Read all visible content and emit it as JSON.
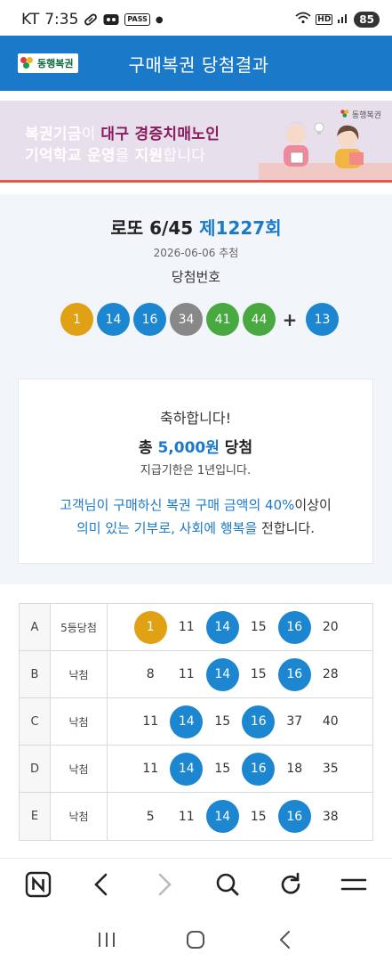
{
  "status_bar": {
    "carrier": "KT",
    "time": "7:35",
    "pass_label": "PASS",
    "hd_label": "HD",
    "battery": "85"
  },
  "header": {
    "logo_text": "동행복권",
    "title": "구매복권 당첨결과"
  },
  "banner": {
    "line1_prefix": "복권기금",
    "line1_mid": "이 ",
    "line1_highlight": "대구 경증치매노인",
    "line2_a": "기억학교 운영",
    "line2_b": "을 ",
    "line2_c": "지원",
    "line2_d": "합니다",
    "logo_text": "동행복권"
  },
  "draw": {
    "game": "로또 6/45 ",
    "round": "제1227회",
    "date": "2026-06-06 추첨",
    "win_label": "당첨번호",
    "numbers": [
      {
        "n": "1",
        "color": "#e0a114"
      },
      {
        "n": "14",
        "color": "#1c86d1"
      },
      {
        "n": "16",
        "color": "#1c86d1"
      },
      {
        "n": "34",
        "color": "#888888"
      },
      {
        "n": "41",
        "color": "#47a93f"
      },
      {
        "n": "44",
        "color": "#47a93f"
      }
    ],
    "plus": "+",
    "bonus": {
      "n": "13",
      "color": "#1c86d1"
    }
  },
  "congrats": {
    "line1": "축하합니다!",
    "total_prefix": "총 ",
    "amount": "5,000원",
    "total_suffix": " 당첨",
    "deadline": "지급기한은 1년입니다.",
    "msg1_a": "고객님이 구매하신 복권 구매 금액의 40%",
    "msg1_b": "이상이",
    "msg2_a": "의미 있는 기부로, 사회에 행복을",
    "msg2_b": " 전합니다."
  },
  "games": [
    {
      "label": "A",
      "result": "5등당첨",
      "nums": [
        {
          "n": "1",
          "hit": true,
          "color": "#e0a114"
        },
        {
          "n": "11",
          "hit": false
        },
        {
          "n": "14",
          "hit": true,
          "color": "#1c86d1"
        },
        {
          "n": "15",
          "hit": false
        },
        {
          "n": "16",
          "hit": true,
          "color": "#1c86d1"
        },
        {
          "n": "20",
          "hit": false
        }
      ]
    },
    {
      "label": "B",
      "result": "낙첨",
      "nums": [
        {
          "n": "8",
          "hit": false
        },
        {
          "n": "11",
          "hit": false
        },
        {
          "n": "14",
          "hit": true,
          "color": "#1c86d1"
        },
        {
          "n": "15",
          "hit": false
        },
        {
          "n": "16",
          "hit": true,
          "color": "#1c86d1"
        },
        {
          "n": "28",
          "hit": false
        }
      ]
    },
    {
      "label": "C",
      "result": "낙첨",
      "nums": [
        {
          "n": "11",
          "hit": false
        },
        {
          "n": "14",
          "hit": true,
          "color": "#1c86d1"
        },
        {
          "n": "15",
          "hit": false
        },
        {
          "n": "16",
          "hit": true,
          "color": "#1c86d1"
        },
        {
          "n": "37",
          "hit": false
        },
        {
          "n": "40",
          "hit": false
        }
      ]
    },
    {
      "label": "D",
      "result": "낙첨",
      "nums": [
        {
          "n": "11",
          "hit": false
        },
        {
          "n": "14",
          "hit": true,
          "color": "#1c86d1"
        },
        {
          "n": "15",
          "hit": false
        },
        {
          "n": "16",
          "hit": true,
          "color": "#1c86d1"
        },
        {
          "n": "18",
          "hit": false
        },
        {
          "n": "35",
          "hit": false
        }
      ]
    },
    {
      "label": "E",
      "result": "낙첨",
      "nums": [
        {
          "n": "5",
          "hit": false
        },
        {
          "n": "11",
          "hit": false
        },
        {
          "n": "14",
          "hit": true,
          "color": "#1c86d1"
        },
        {
          "n": "15",
          "hit": false
        },
        {
          "n": "16",
          "hit": true,
          "color": "#1c86d1"
        },
        {
          "n": "38",
          "hit": false
        }
      ]
    }
  ],
  "toolbar": {
    "icons": [
      "naver-icon",
      "back-arrow-icon",
      "forward-arrow-icon",
      "search-icon",
      "refresh-icon",
      "menu-icon"
    ]
  },
  "navbar": {
    "icons": [
      "recent-apps-icon",
      "home-icon",
      "back-icon"
    ]
  }
}
